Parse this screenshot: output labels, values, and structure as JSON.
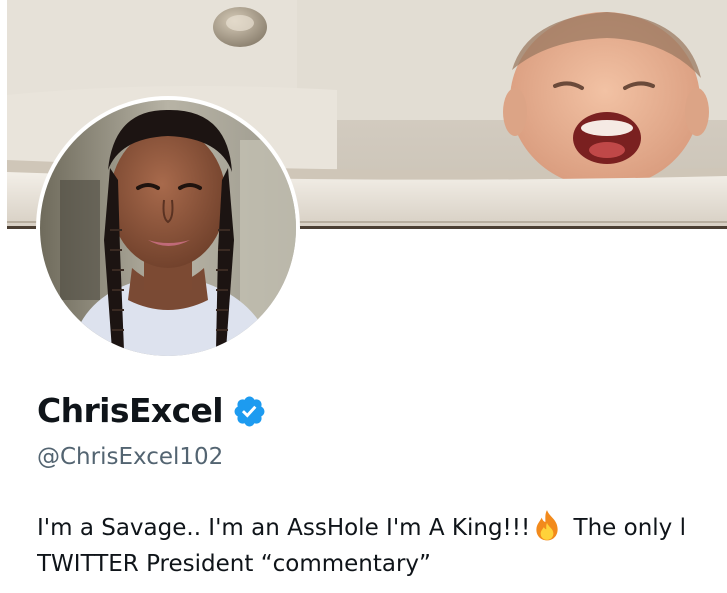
{
  "profile": {
    "display_name": "ChrisExcel",
    "handle": "@ChrisExcel102",
    "verified_badge": "verified-checkmark-icon",
    "bio": {
      "line1_before_icon": "I'm a Savage.. I'm an AssHole I'm A King!!!",
      "icon": "fire-icon",
      "line1_after_icon": " The only l",
      "line2": "TWITTER President “commentary”"
    }
  },
  "colors": {
    "text_primary": "#0f1419",
    "text_secondary": "#536471",
    "verified_blue": "#1d9bf0",
    "background": "#ffffff"
  }
}
